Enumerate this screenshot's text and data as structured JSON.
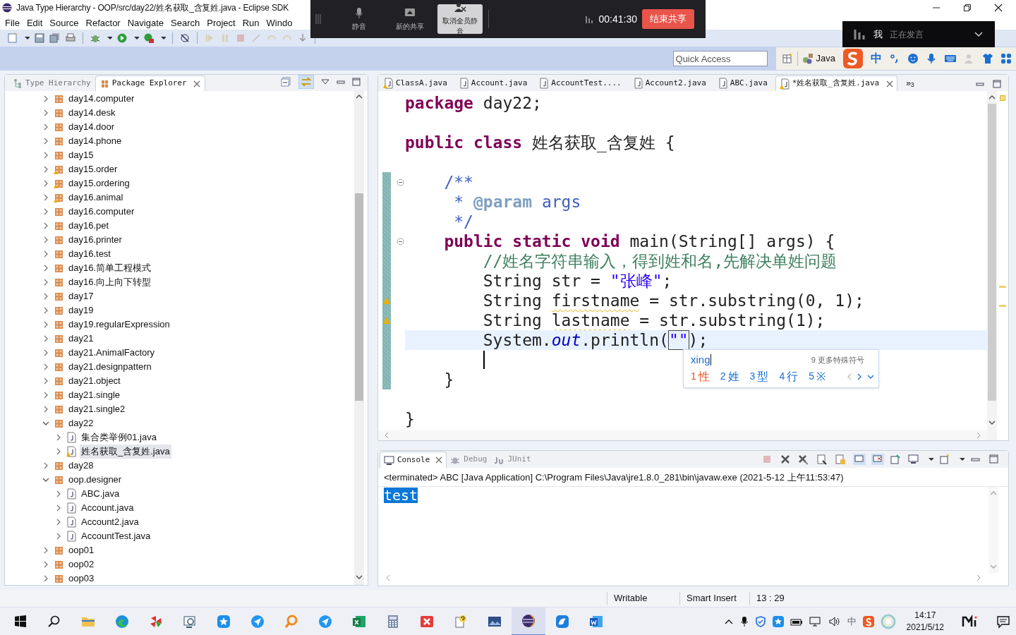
{
  "window": {
    "title": "Java Type Hierarchy - OOP/src/day22/姓名获取_含复姓.java - Eclipse SDK"
  },
  "menu": [
    "File",
    "Edit",
    "Source",
    "Refactor",
    "Navigate",
    "Search",
    "Project",
    "Run",
    "Windo"
  ],
  "quick_access": {
    "placeholder": "Quick Access"
  },
  "perspective": {
    "label": "Java"
  },
  "ime_toolbar": {
    "mode": "中"
  },
  "meeting_bar": {
    "buttons": [
      {
        "label": "静音",
        "kind": "mic",
        "selected": false
      },
      {
        "label": "新的共享",
        "kind": "share",
        "selected": false
      },
      {
        "label": "取消全员静音",
        "kind": "mute_all",
        "selected": true
      }
    ],
    "timer": "00:41:30",
    "end_button": "结束共享"
  },
  "speaker_panel": {
    "name": "我",
    "status": "正在发言"
  },
  "left_panel": {
    "tabs": [
      {
        "label": "Type Hierarchy",
        "selected": false
      },
      {
        "label": "Package Explorer",
        "selected": true
      }
    ],
    "tree": [
      {
        "label": "day14.computer",
        "kind": "package",
        "warning": false,
        "expanded": false,
        "selected": false
      },
      {
        "label": "day14.desk",
        "kind": "package",
        "warning": false,
        "expanded": false,
        "selected": false
      },
      {
        "label": "day14.door",
        "kind": "package",
        "warning": false,
        "expanded": false,
        "selected": false
      },
      {
        "label": "day14.phone",
        "kind": "package",
        "warning": false,
        "expanded": false,
        "selected": false
      },
      {
        "label": "day15",
        "kind": "package",
        "warning": false,
        "expanded": false,
        "selected": false
      },
      {
        "label": "day15.order",
        "kind": "package",
        "warning": true,
        "expanded": false,
        "selected": false
      },
      {
        "label": "day15.ordering",
        "kind": "package",
        "warning": true,
        "expanded": false,
        "selected": false
      },
      {
        "label": "day16.animal",
        "kind": "package",
        "warning": true,
        "expanded": false,
        "selected": false
      },
      {
        "label": "day16.computer",
        "kind": "package",
        "warning": false,
        "expanded": false,
        "selected": false
      },
      {
        "label": "day16.pet",
        "kind": "package",
        "warning": false,
        "expanded": false,
        "selected": false
      },
      {
        "label": "day16.printer",
        "kind": "package",
        "warning": false,
        "expanded": false,
        "selected": false
      },
      {
        "label": "day16.test",
        "kind": "package",
        "warning": false,
        "expanded": false,
        "selected": false
      },
      {
        "label": "day16.简单工程模式",
        "kind": "package",
        "warning": false,
        "expanded": false,
        "selected": false
      },
      {
        "label": "day16.向上向下转型",
        "kind": "package",
        "warning": false,
        "expanded": false,
        "selected": false
      },
      {
        "label": "day17",
        "kind": "package",
        "warning": false,
        "expanded": false,
        "selected": false
      },
      {
        "label": "day19",
        "kind": "package",
        "warning": false,
        "expanded": false,
        "selected": false
      },
      {
        "label": "day19.regularExpression",
        "kind": "package",
        "warning": false,
        "expanded": false,
        "selected": false
      },
      {
        "label": "day21",
        "kind": "package",
        "warning": false,
        "expanded": false,
        "selected": false
      },
      {
        "label": "day21.AnimalFactory",
        "kind": "package",
        "warning": false,
        "expanded": false,
        "selected": false
      },
      {
        "label": "day21.designpattern",
        "kind": "package",
        "warning": false,
        "expanded": false,
        "selected": false
      },
      {
        "label": "day21.object",
        "kind": "package",
        "warning": false,
        "expanded": false,
        "selected": false
      },
      {
        "label": "day21.single",
        "kind": "package",
        "warning": false,
        "expanded": false,
        "selected": false
      },
      {
        "label": "day21.single2",
        "kind": "package",
        "warning": false,
        "expanded": false,
        "selected": false
      },
      {
        "label": "day22",
        "kind": "package",
        "warning": false,
        "expanded": true,
        "selected": false,
        "children": [
          {
            "label": "集合类举例01.java",
            "kind": "file",
            "warning": false,
            "expanded": false,
            "selected": false
          },
          {
            "label": "姓名获取_含复姓.java",
            "kind": "file",
            "warning": true,
            "expanded": false,
            "selected": true
          }
        ]
      },
      {
        "label": "day28",
        "kind": "package",
        "warning": false,
        "expanded": false,
        "selected": false
      },
      {
        "label": "oop.designer",
        "kind": "package",
        "warning": false,
        "expanded": true,
        "selected": false,
        "children": [
          {
            "label": "ABC.java",
            "kind": "file",
            "warning": false,
            "expanded": false,
            "selected": false
          },
          {
            "label": "Account.java",
            "kind": "file",
            "warning": false,
            "expanded": false,
            "selected": false
          },
          {
            "label": "Account2.java",
            "kind": "file",
            "warning": false,
            "expanded": false,
            "selected": false
          },
          {
            "label": "AccountTest.java",
            "kind": "file",
            "warning": false,
            "expanded": false,
            "selected": false
          }
        ]
      },
      {
        "label": "oop01",
        "kind": "package",
        "warning": false,
        "expanded": false,
        "selected": false
      },
      {
        "label": "oop02",
        "kind": "package",
        "warning": false,
        "expanded": false,
        "selected": false
      },
      {
        "label": "oop03",
        "kind": "package",
        "warning": false,
        "expanded": false,
        "selected": false
      }
    ]
  },
  "editor": {
    "tabs": [
      {
        "label": "ClassA.java",
        "warning": true,
        "selected": false
      },
      {
        "label": "Account.java",
        "warning": false,
        "selected": false
      },
      {
        "label": "AccountTest....",
        "warning": false,
        "selected": false
      },
      {
        "label": "Account2.java",
        "warning": false,
        "selected": false
      },
      {
        "label": "ABC.java",
        "warning": false,
        "selected": false
      },
      {
        "label": "*姓名获取_含复姓.java",
        "warning": true,
        "selected": true
      }
    ],
    "more_tabs": "»$_{3}$",
    "lines": [
      {
        "changed": false,
        "fold": false,
        "warning": false,
        "current": false,
        "caret": false,
        "tokens": [
          {
            "kind": "keyword",
            "text": "package"
          },
          {
            "kind": "plain",
            "text": " day22;"
          }
        ]
      },
      {
        "changed": false,
        "fold": false,
        "warning": false,
        "current": false,
        "caret": false
      },
      {
        "changed": false,
        "fold": false,
        "warning": false,
        "current": false,
        "caret": false,
        "tokens": [
          {
            "kind": "keyword",
            "text": "public class"
          },
          {
            "kind": "plain",
            "text": " 姓名获取_含复姓 {"
          }
        ]
      },
      {
        "changed": false,
        "fold": false,
        "warning": false,
        "current": false,
        "caret": false
      },
      {
        "changed": true,
        "fold": true,
        "warning": false,
        "current": false,
        "caret": false,
        "tokens": [
          {
            "kind": "javadoc",
            "text": "    /**"
          }
        ]
      },
      {
        "changed": true,
        "fold": false,
        "warning": false,
        "current": false,
        "caret": false,
        "tokens": [
          {
            "kind": "javadoc",
            "text": "     * "
          },
          {
            "kind": "javadoc_tag",
            "text": "@param"
          },
          {
            "kind": "javadoc",
            "text": " args"
          }
        ]
      },
      {
        "changed": true,
        "fold": false,
        "warning": false,
        "current": false,
        "caret": false,
        "tokens": [
          {
            "kind": "javadoc",
            "text": "     */"
          }
        ]
      },
      {
        "changed": true,
        "fold": true,
        "warning": false,
        "current": false,
        "caret": false,
        "tokens": [
          {
            "kind": "keyword",
            "text": "    public static void"
          },
          {
            "kind": "plain",
            "text": " main(String[] args) {"
          }
        ]
      },
      {
        "changed": true,
        "fold": false,
        "warning": false,
        "current": false,
        "caret": false,
        "tokens": [
          {
            "kind": "comment",
            "text": "        //姓名字符串输入，得到姓和名,先解决单姓问题"
          }
        ]
      },
      {
        "changed": true,
        "fold": false,
        "warning": false,
        "current": false,
        "caret": false,
        "tokens": [
          {
            "kind": "plain",
            "text": "        String str = "
          },
          {
            "kind": "string",
            "text": "\"张峰\""
          },
          {
            "kind": "plain",
            "text": ";"
          }
        ]
      },
      {
        "changed": true,
        "fold": false,
        "warning": true,
        "current": false,
        "caret": false,
        "tokens": [
          {
            "kind": "plain",
            "text": "        String "
          },
          {
            "kind": "unused",
            "text": "firstname"
          },
          {
            "kind": "plain",
            "text": " = str.substring(0, 1);"
          }
        ]
      },
      {
        "changed": true,
        "fold": false,
        "warning": true,
        "current": false,
        "caret": false,
        "tokens": [
          {
            "kind": "plain",
            "text": "        String "
          },
          {
            "kind": "unused",
            "text": "lastname"
          },
          {
            "kind": "plain",
            "text": " = str.substring(1);"
          }
        ]
      },
      {
        "changed": true,
        "fold": false,
        "warning": false,
        "current": true,
        "caret": false,
        "tokens": [
          {
            "kind": "plain",
            "text": "        System."
          },
          {
            "kind": "static_field",
            "text": "out"
          },
          {
            "kind": "plain",
            "text": ".println("
          },
          {
            "kind": "linked",
            "text": "\"\""
          },
          {
            "kind": "plain",
            "text": ");"
          }
        ]
      },
      {
        "changed": true,
        "fold": false,
        "warning": false,
        "current": false,
        "caret": true
      },
      {
        "changed": true,
        "fold": false,
        "warning": false,
        "current": false,
        "caret": false,
        "tokens": [
          {
            "kind": "plain",
            "text": "    }"
          }
        ]
      },
      {
        "changed": false,
        "fold": false,
        "warning": false,
        "current": false,
        "caret": false
      },
      {
        "changed": false,
        "fold": false,
        "warning": false,
        "current": false,
        "caret": false,
        "tokens": [
          {
            "kind": "plain",
            "text": "}"
          }
        ]
      }
    ]
  },
  "ime_popup": {
    "input": "xing",
    "hint": "9 更多特殊符号",
    "candidates": [
      {
        "index": "1",
        "text": "性",
        "selected": true
      },
      {
        "index": "2",
        "text": "姓",
        "selected": false
      },
      {
        "index": "3",
        "text": "型",
        "selected": false
      },
      {
        "index": "4",
        "text": "行",
        "selected": false
      },
      {
        "index": "5",
        "text": "※",
        "selected": false
      }
    ]
  },
  "console": {
    "tabs": [
      {
        "label": "Console",
        "kind": "console",
        "selected": true
      },
      {
        "label": "Debug",
        "kind": "debug",
        "selected": false
      },
      {
        "label": "JUnit",
        "kind": "junit",
        "selected": false
      }
    ],
    "header": "<terminated> ABC [Java Application] C:\\Program Files\\Java\\jre1.8.0_281\\bin\\javaw.exe (2021-5-12 上午11:53:47)",
    "output": [
      {
        "text": "test",
        "selected": true
      }
    ]
  },
  "status_bar": [
    "Writable",
    "Smart Insert",
    "13 : 29"
  ],
  "taskbar": {
    "apps": [
      {
        "kind": "start",
        "active": false
      },
      {
        "kind": "search",
        "active": false
      },
      {
        "kind": "folder",
        "active": false
      },
      {
        "kind": "edge",
        "active": false
      },
      {
        "kind": "pinwheel",
        "active": false
      },
      {
        "kind": "viewer",
        "active": false
      },
      {
        "kind": "star",
        "active": false
      },
      {
        "kind": "feather",
        "active": false
      },
      {
        "kind": "magnifier",
        "active": false
      },
      {
        "kind": "feather",
        "active": false
      },
      {
        "kind": "excel",
        "active": false
      },
      {
        "kind": "calculator",
        "active": false
      },
      {
        "kind": "xmind",
        "active": false
      },
      {
        "kind": "help",
        "active": false
      },
      {
        "kind": "photo",
        "active": false
      },
      {
        "kind": "eclipse",
        "active": true
      },
      {
        "kind": "bird",
        "active": false
      },
      {
        "kind": "word",
        "active": false
      }
    ],
    "tray_ime": "中",
    "time": "14:17",
    "date": "2021/5/12"
  }
}
